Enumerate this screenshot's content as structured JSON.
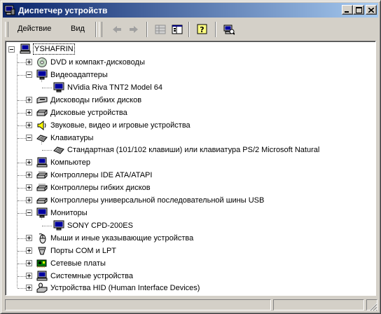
{
  "window": {
    "title": "Диспетчер устройств",
    "title_color": "#ffffff",
    "titlebar_start": "#0a246a",
    "titlebar_end": "#a6caf0"
  },
  "menu": {
    "action": "Действие",
    "view": "Вид"
  },
  "toolbar": {
    "icons": [
      "back-arrow-icon",
      "forward-arrow-icon",
      "properties-grid-icon",
      "view-panel-icon",
      "help-icon",
      "scan-hardware-icon"
    ]
  },
  "tree": {
    "root": "YSHAFRIN",
    "categories": [
      {
        "label": "DVD и компакт-дисководы",
        "icon": "cdrom-icon",
        "expanded": false
      },
      {
        "label": "Видеоадаптеры",
        "icon": "monitor-icon",
        "expanded": true,
        "children": [
          "NVidia Riva TNT2 Model 64"
        ]
      },
      {
        "label": "Дисководы гибких дисков",
        "icon": "floppy-drive-icon",
        "expanded": false
      },
      {
        "label": "Дисковые устройства",
        "icon": "disk-drive-icon",
        "expanded": false
      },
      {
        "label": "Звуковые, видео и игровые устройства",
        "icon": "speaker-icon",
        "expanded": false
      },
      {
        "label": "Клавиатуры",
        "icon": "keyboard-icon",
        "expanded": true,
        "children": [
          "Стандартная (101/102 клавиши) или клавиатура PS/2 Microsoft Natural"
        ]
      },
      {
        "label": "Компьютер",
        "icon": "computer-icon",
        "expanded": false
      },
      {
        "label": "Контроллеры IDE ATA/ATAPI",
        "icon": "controller-icon",
        "expanded": false
      },
      {
        "label": "Контроллеры гибких дисков",
        "icon": "controller-icon",
        "expanded": false
      },
      {
        "label": "Контроллеры универсальной последовательной шины USB",
        "icon": "usb-icon",
        "expanded": false
      },
      {
        "label": "Мониторы",
        "icon": "monitor-icon",
        "expanded": true,
        "children": [
          "SONY CPD-200ES"
        ]
      },
      {
        "label": "Мыши и иные указывающие устройства",
        "icon": "mouse-icon",
        "expanded": false
      },
      {
        "label": "Порты COM и LPT",
        "icon": "port-icon",
        "expanded": false
      },
      {
        "label": "Сетевые платы",
        "icon": "network-card-icon",
        "expanded": false
      },
      {
        "label": "Системные устройства",
        "icon": "computer-icon",
        "expanded": false
      },
      {
        "label": "Устройства HID (Human Interface Devices)",
        "icon": "hid-icon",
        "expanded": false
      }
    ]
  }
}
